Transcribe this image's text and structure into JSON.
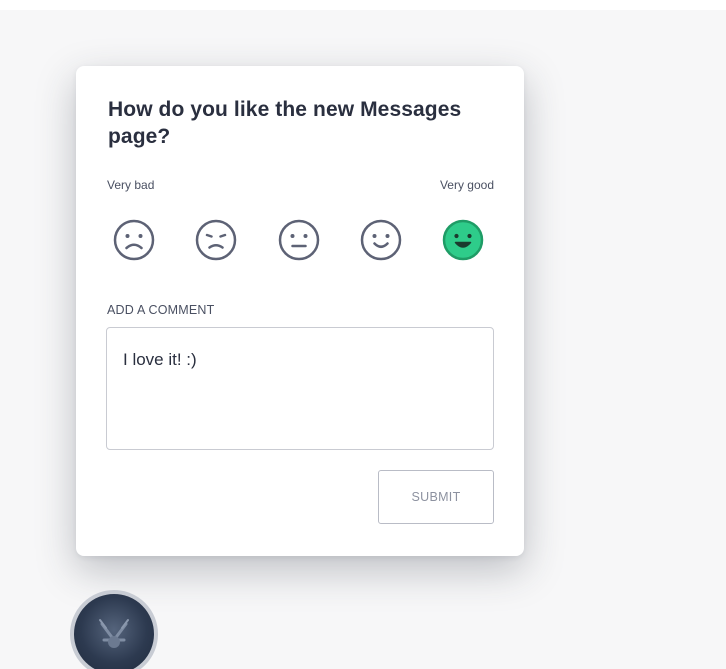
{
  "survey": {
    "title": "How do you like the new Messages page?",
    "scale_low": "Very bad",
    "scale_high": "Very good",
    "faces": [
      {
        "icon": "very-sad-face-icon",
        "selected": false
      },
      {
        "icon": "sad-face-icon",
        "selected": false
      },
      {
        "icon": "neutral-face-icon",
        "selected": false
      },
      {
        "icon": "happy-face-icon",
        "selected": false
      },
      {
        "icon": "very-happy-face-icon",
        "selected": true
      }
    ],
    "comment_label": "ADD A COMMENT",
    "comment_value": "I love it! :)",
    "submit_label": "SUBMIT"
  },
  "colors": {
    "selected_fill": "#2ecc8a",
    "face_stroke": "#5d6275"
  }
}
